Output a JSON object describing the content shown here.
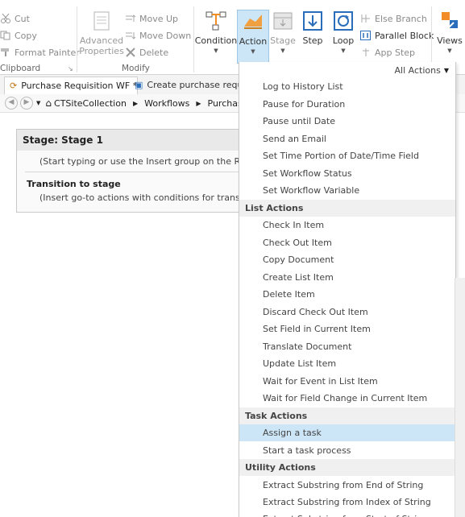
{
  "ribbon": {
    "clipboard": {
      "cut": "Cut",
      "copy": "Copy",
      "format_painter": "Format Painter",
      "group_label": "Clipboard"
    },
    "modify": {
      "advanced_properties_1": "Advanced",
      "advanced_properties_2": "Properties",
      "move_up": "Move Up",
      "move_down": "Move Down",
      "delete": "Delete",
      "group_label": "Modify"
    },
    "insert": {
      "condition": "Condition",
      "action": "Action",
      "stage": "Stage",
      "step": "Step",
      "loop": "Loop",
      "else_branch": "Else Branch",
      "parallel_block": "Parallel Block",
      "app_step": "App Step",
      "views": "Views"
    }
  },
  "tabs": [
    {
      "label": "Purchase Requisition WF *"
    },
    {
      "label": "Create purchase requisit"
    }
  ],
  "breadcrumb": [
    "CTSiteCollection",
    "Workflows",
    "Purchase I"
  ],
  "stage": {
    "title": "Stage: Stage 1",
    "hint": "(Start typing or use the Insert group on the Ribbon.)",
    "transition_title": "Transition to stage",
    "transition_hint": "(Insert go-to actions with conditions for transitioning"
  },
  "menu": {
    "all_actions": "All Actions",
    "items_top": [
      "Log to History List",
      "Pause for Duration",
      "Pause until Date",
      "Send an Email",
      "Set Time Portion of Date/Time Field",
      "Set Workflow Status",
      "Set Workflow Variable"
    ],
    "list_actions_header": "List Actions",
    "list_actions": [
      "Check In Item",
      "Check Out Item",
      "Copy Document",
      "Create List Item",
      "Delete Item",
      "Discard Check Out Item",
      "Set Field in Current Item",
      "Translate Document",
      "Update List Item",
      "Wait for Event in List Item",
      "Wait for Field Change in Current Item"
    ],
    "task_actions_header": "Task Actions",
    "task_actions": [
      "Assign a task",
      "Start a task process"
    ],
    "utility_actions_header": "Utility Actions",
    "utility_actions": [
      "Extract Substring from End of String",
      "Extract Substring from Index of String",
      "Extract Substring from Start of String"
    ]
  },
  "colors": {
    "highlight": "#cde6f7",
    "header_bg": "#f0f0f0"
  }
}
